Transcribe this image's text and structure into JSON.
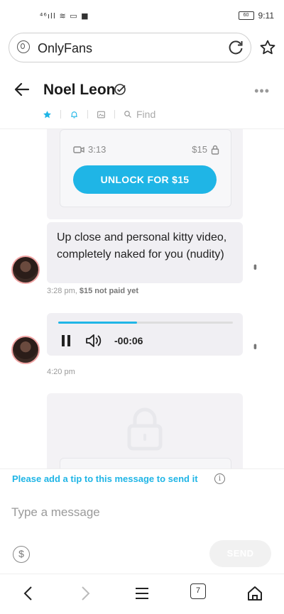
{
  "status_bar": {
    "icons_text": "⁴⁶ıll ≋ ▭ ■",
    "battery": "60",
    "time": "9:11"
  },
  "browser": {
    "url_text": "OnlyFans",
    "tabs_count": "7"
  },
  "chat_header": {
    "name": "Noel Leon",
    "find_label": "Find"
  },
  "messages": {
    "locked_video": {
      "duration": "3:13",
      "price": "$15",
      "unlock_label": "UNLOCK FOR $15"
    },
    "text_message": {
      "text": "Up close and personal kitty video, completely naked for you (nudity)",
      "time": "3:28 pm,",
      "status": "$15 not paid yet"
    },
    "audio_message": {
      "time_remaining": "-00:06",
      "progress": 0.45,
      "time": "4:20 pm"
    }
  },
  "composer": {
    "tip_notice": "Please add a tip to this message to send it",
    "placeholder": "Type a message",
    "send_label": "SEND"
  },
  "colors": {
    "accent": "#1fb5e6",
    "bubble": "#f0eff3"
  }
}
